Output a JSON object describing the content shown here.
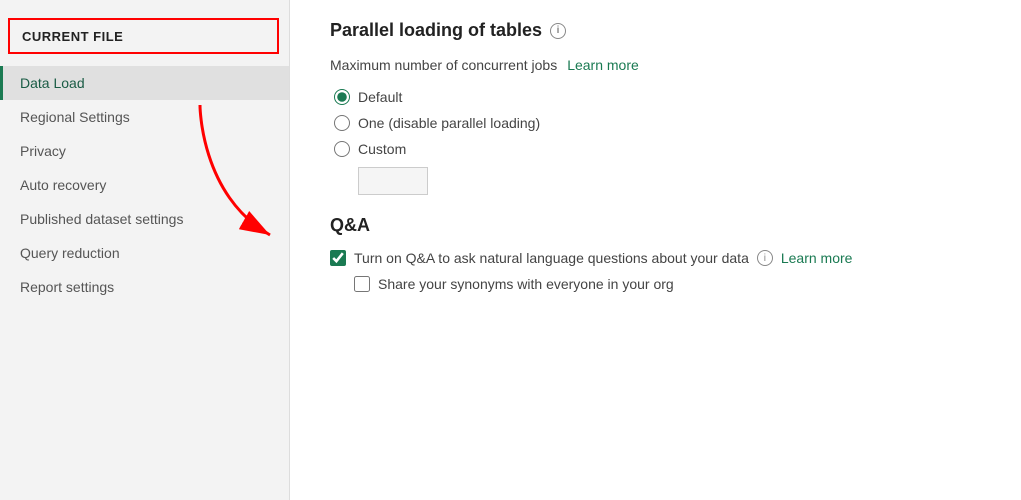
{
  "sidebar": {
    "header": "CURRENT FILE",
    "items": [
      {
        "id": "data-load",
        "label": "Data Load",
        "active": true
      },
      {
        "id": "regional-settings",
        "label": "Regional Settings",
        "active": false
      },
      {
        "id": "privacy",
        "label": "Privacy",
        "active": false
      },
      {
        "id": "auto-recovery",
        "label": "Auto recovery",
        "active": false
      },
      {
        "id": "published-dataset-settings",
        "label": "Published dataset settings",
        "active": false
      },
      {
        "id": "query-reduction",
        "label": "Query reduction",
        "active": false
      },
      {
        "id": "report-settings",
        "label": "Report settings",
        "active": false
      }
    ]
  },
  "main": {
    "parallel_loading_title": "Parallel loading of tables",
    "concurrent_jobs_label": "Maximum number of concurrent jobs",
    "learn_more_parallel": "Learn more",
    "radio_options": [
      {
        "id": "default",
        "label": "Default",
        "checked": true
      },
      {
        "id": "one",
        "label": "One (disable parallel loading)",
        "checked": false
      },
      {
        "id": "custom",
        "label": "Custom",
        "checked": false
      }
    ],
    "qa_title": "Q&A",
    "qa_checkbox_label": "Turn on Q&A to ask natural language questions about your data",
    "qa_learn_more": "Learn more",
    "synonyms_checkbox_label": "Share your synonyms with everyone in your org"
  }
}
